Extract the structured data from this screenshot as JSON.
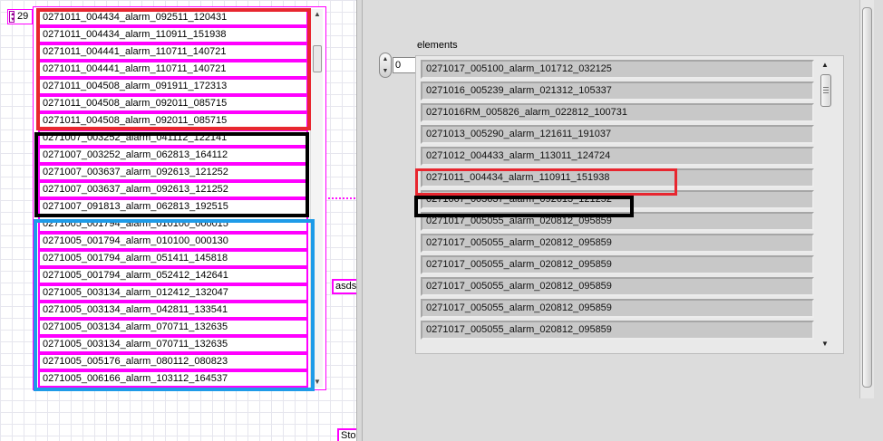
{
  "left": {
    "index_value": "29",
    "array_items": [
      "0271011_004434_alarm_092511_120431",
      "0271011_004434_alarm_110911_151938",
      "0271011_004441_alarm_110711_140721",
      "0271011_004441_alarm_110711_140721",
      "0271011_004508_alarm_091911_172313",
      "0271011_004508_alarm_092011_085715",
      "0271011_004508_alarm_092011_085715",
      "0271007_003252_alarm_041112_122141",
      "0271007_003252_alarm_062813_164112",
      "0271007_003637_alarm_092613_121252",
      "0271007_003637_alarm_092613_121252",
      "0271007_091813_alarm_062813_192515",
      "0271005_001794_alarm_010100_000015",
      "0271005_001794_alarm_010100_000130",
      "0271005_001794_alarm_051411_145818",
      "0271005_001794_alarm_052412_142641",
      "0271005_003134_alarm_012412_132047",
      "0271005_003134_alarm_042811_133541",
      "0271005_003134_alarm_070711_132635",
      "0271005_003134_alarm_070711_132635",
      "0271005_005176_alarm_080112_080823",
      "0271005_006166_alarm_103112_164537"
    ],
    "string_constant": "asdsa",
    "stop_constant": "Stop"
  },
  "right": {
    "label": "elements",
    "index_value": "0",
    "elements": [
      "0271017_005100_alarm_101712_032125",
      "0271016_005239_alarm_021312_105337",
      "0271016RM_005826_alarm_022812_100731",
      "0271013_005290_alarm_121611_191037",
      "0271012_004433_alarm_113011_124724",
      "0271011_004434_alarm_110911_151938",
      "0271007_003637_alarm_092613_121252",
      "0271017_005055_alarm_020812_095859",
      "0271017_005055_alarm_020812_095859",
      "0271017_005055_alarm_020812_095859",
      "0271017_005055_alarm_020812_095859",
      "0271017_005055_alarm_020812_095859",
      "0271017_005055_alarm_020812_095859"
    ]
  },
  "colors": {
    "wire_pink": "#ff00ff",
    "highlight_red": "#e8262f",
    "highlight_black": "#000000",
    "highlight_blue": "#1e9be8"
  },
  "icons": {
    "scroll_up": "▲",
    "scroll_down": "▼",
    "spin_up": "▲",
    "spin_down": "▼"
  }
}
